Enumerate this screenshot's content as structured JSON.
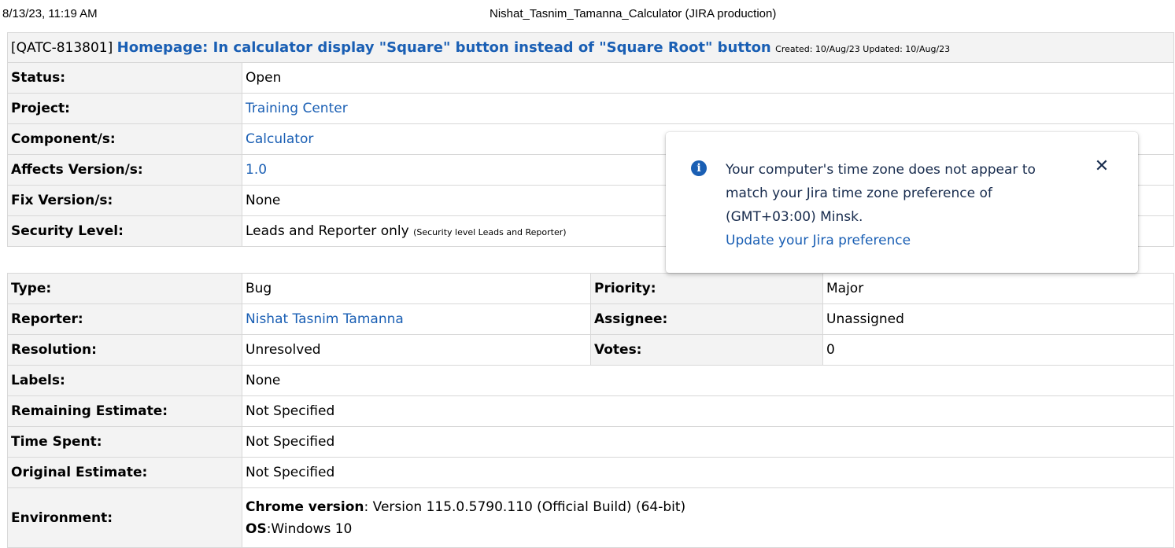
{
  "print_header": {
    "date": "8/13/23, 11:19 AM",
    "title": "Nishat_Tasnim_Tamanna_Calculator (JIRA production)"
  },
  "issue": {
    "key": "[QATC-813801]",
    "summary": "Homepage: In calculator display \"Square\" button instead of \"Square Root\" button",
    "dates": "Created: 10/Aug/23  Updated: 10/Aug/23"
  },
  "fields": {
    "status": {
      "label": "Status:",
      "value": "Open"
    },
    "project": {
      "label": "Project:",
      "value": "Training Center"
    },
    "component": {
      "label": "Component/s:",
      "value": "Calculator"
    },
    "affects_version": {
      "label": "Affects Version/s:",
      "value": "1.0"
    },
    "fix_version": {
      "label": "Fix Version/s:",
      "value": "None"
    },
    "security_level": {
      "label": "Security Level:",
      "value": "Leads and Reporter only",
      "note": "(Security level Leads and Reporter)"
    }
  },
  "details": {
    "type": {
      "label": "Type:",
      "value": "Bug"
    },
    "priority": {
      "label": "Priority:",
      "value": "Major"
    },
    "reporter": {
      "label": "Reporter:",
      "value": "Nishat Tasnim Tamanna"
    },
    "assignee": {
      "label": "Assignee:",
      "value": "Unassigned"
    },
    "resolution": {
      "label": "Resolution:",
      "value": "Unresolved"
    },
    "votes": {
      "label": "Votes:",
      "value": "0"
    },
    "labels": {
      "label": "Labels:",
      "value": "None"
    },
    "remaining_estimate": {
      "label": "Remaining Estimate:",
      "value": "Not Specified"
    },
    "time_spent": {
      "label": "Time Spent:",
      "value": "Not Specified"
    },
    "original_estimate": {
      "label": "Original Estimate:",
      "value": "Not Specified"
    },
    "environment": {
      "label": "Environment:",
      "chrome_label": "Chrome version",
      "chrome_value": ": Version 115.0.5790.110 (Official Build) (64-bit)",
      "os_label": "OS",
      "os_value": ":Windows 10"
    }
  },
  "toast": {
    "icon": "info-icon",
    "message": "Your computer's time zone does not appear to match your Jira time zone preference of (GMT+03:00) Minsk.",
    "link": "Update your Jira preference",
    "close_icon": "close-icon",
    "close_glyph": "✕"
  },
  "colors": {
    "link": "#1a5fb4",
    "label_bg": "#f3f3f3",
    "border": "#d8d8d8"
  }
}
